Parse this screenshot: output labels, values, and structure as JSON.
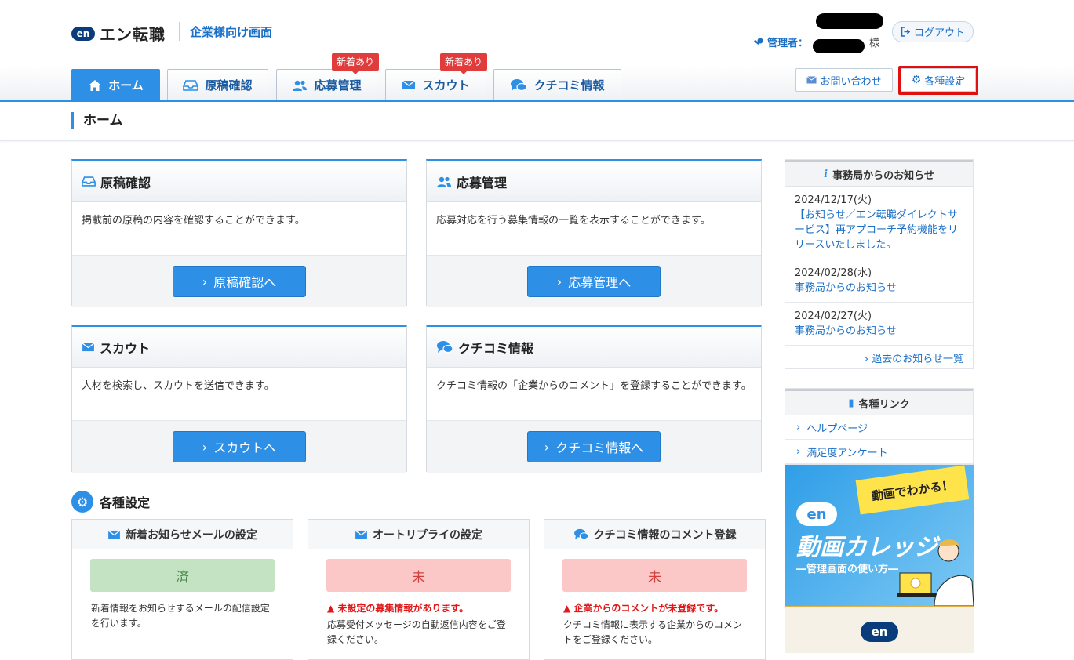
{
  "header": {
    "logo_mark": "en",
    "logo_text": "エン転職",
    "subtitle": "企業様向け画面",
    "admin_label": "管理者：",
    "admin_suffix": "様",
    "logout_label": "ログアウト"
  },
  "tabs": [
    {
      "label": "ホーム",
      "active": true
    },
    {
      "label": "原稿確認"
    },
    {
      "label": "応募管理",
      "badge": "新着あり"
    },
    {
      "label": "スカウト",
      "badge": "新着あり"
    },
    {
      "label": "クチコミ情報"
    }
  ],
  "header_buttons": {
    "contact": "お問い合わせ",
    "settings": "各種設定"
  },
  "page_title": "ホーム",
  "cards": [
    {
      "title": "原稿確認",
      "desc": "掲載前の原稿の内容を確認することができます。",
      "button": "原稿確認へ"
    },
    {
      "title": "応募管理",
      "desc": "応募対応を行う募集情報の一覧を表示することができます。",
      "button": "応募管理へ"
    },
    {
      "title": "スカウト",
      "desc": "人材を検索し、スカウトを送信できます。",
      "button": "スカウトへ"
    },
    {
      "title": "クチコミ情報",
      "desc": "クチコミ情報の「企業からのコメント」を登録することができます。",
      "button": "クチコミ情報へ"
    }
  ],
  "settings": {
    "title": "各種設定",
    "items": [
      {
        "title": "新着お知らせメールの設定",
        "status": "済",
        "warning": "",
        "desc": "新着情報をお知らせするメールの配信設定を行います。"
      },
      {
        "title": "オートリプライの設定",
        "status": "未",
        "warning": "未設定の募集情報があります。",
        "desc": "応募受付メッセージの自動返信内容をご登録ください。"
      },
      {
        "title": "クチコミ情報のコメント登録",
        "status": "未",
        "warning": "企業からのコメントが未登録です。",
        "desc": "クチコミ情報に表示する企業からのコメントをご登録ください。"
      }
    ]
  },
  "sidebar": {
    "news_title": "事務局からのお知らせ",
    "news": [
      {
        "date": "2024/12/17(火)",
        "text": "【お知らせ／エン転職ダイレクトサービス】再アプローチ予約機能をリリースいたしました。"
      },
      {
        "date": "2024/02/28(水)",
        "text": "事務局からのお知らせ"
      },
      {
        "date": "2024/02/27(火)",
        "text": "事務局からのお知らせ"
      }
    ],
    "news_more": "過去のお知らせ一覧",
    "links_title": "各種リンク",
    "links": [
      "ヘルプページ",
      "満足度アンケート"
    ],
    "banner": {
      "bubble": "動画でわかる！",
      "mark": "en",
      "title": "動画カレッジ",
      "subtitle": "―管理画面の使い方―"
    },
    "banner2_mark": "en"
  },
  "colors": {
    "accent": "#2d8fe6",
    "badge": "#e03c3c",
    "highlight_border": "#e01010",
    "done_bg": "#c3e3c3",
    "todo_bg": "#fbc7c7"
  }
}
